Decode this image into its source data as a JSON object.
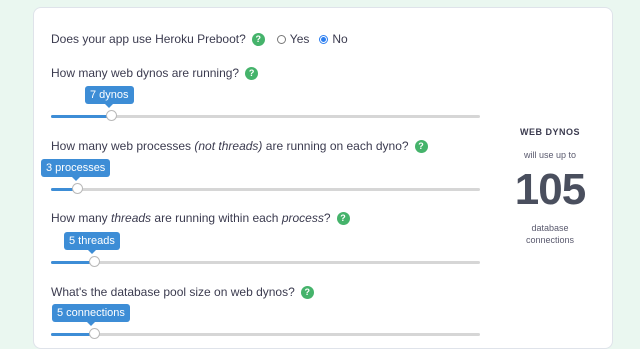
{
  "questions": {
    "preboot": {
      "label": "Does your app use Heroku Preboot?",
      "help": "?",
      "options": [
        {
          "label": "Yes",
          "selected": false
        },
        {
          "label": "No",
          "selected": true
        }
      ]
    },
    "dynos": {
      "label": "How many web dynos are running?",
      "help": "?",
      "slider_label": "7 dynos",
      "value_fraction": 0.14
    },
    "processes": {
      "label_before": "How many web processes ",
      "label_em": "(not threads)",
      "label_after": " are running on each dyno?",
      "help": "?",
      "slider_label": "3 processes",
      "value_fraction": 0.06
    },
    "threads": {
      "label_before": "How many ",
      "label_em": "threads",
      "label_mid": " are running within each ",
      "label_em2": "process",
      "label_after": "?",
      "help": "?",
      "slider_label": "5 threads",
      "value_fraction": 0.1
    },
    "pool": {
      "label": "What's the database pool size on web dynos?",
      "help": "?",
      "slider_label": "5 connections",
      "value_fraction": 0.1
    }
  },
  "summary": {
    "title": "WEB DYNOS",
    "subtitle": "will use up to",
    "count": "105",
    "foot_line1": "database",
    "foot_line2": "connections"
  },
  "colors": {
    "accent": "#3d8dd6",
    "help": "#45b36b",
    "background": "#eaf7f0"
  }
}
